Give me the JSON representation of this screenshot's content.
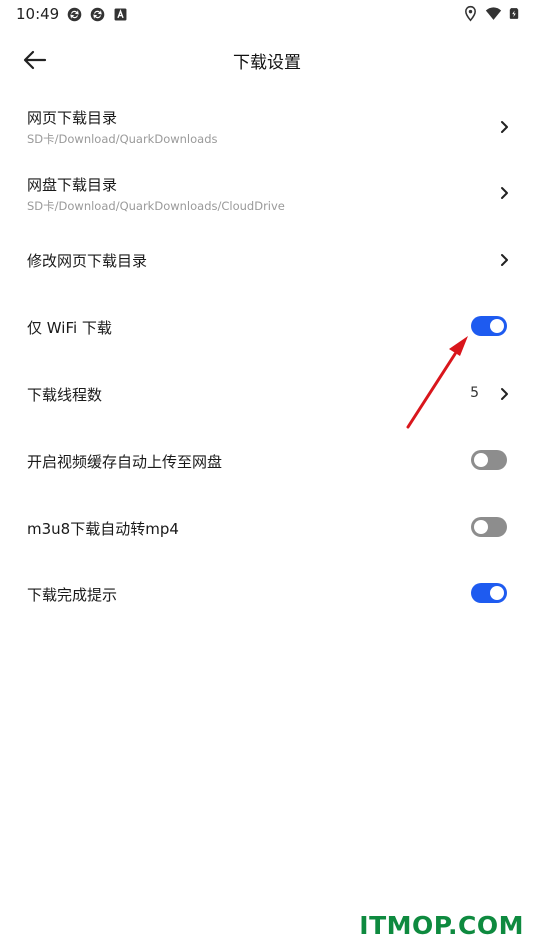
{
  "status_bar": {
    "time": "10:49",
    "icons_left": [
      "sync-icon",
      "sync-icon",
      "font-a-icon"
    ],
    "icons_right": [
      "location-icon",
      "wifi-icon",
      "battery-charging-icon"
    ]
  },
  "header": {
    "title": "下载设置",
    "back_icon": "arrow-left-icon"
  },
  "settings": {
    "web_dir": {
      "label": "网页下载目录",
      "sub": "SD卡/Download/QuarkDownloads"
    },
    "cloud_dir": {
      "label": "网盘下载目录",
      "sub": "SD卡/Download/QuarkDownloads/CloudDrive"
    },
    "modify_web_dir": {
      "label": "修改网页下载目录"
    },
    "wifi_only": {
      "label": "仅 WiFi 下载",
      "enabled": true
    },
    "threads": {
      "label": "下载线程数",
      "value": "5"
    },
    "video_cache_upload": {
      "label": "开启视频缓存自动上传至网盘",
      "enabled": false
    },
    "m3u8_to_mp4": {
      "label": "m3u8下载自动转mp4",
      "enabled": false
    },
    "complete_notice": {
      "label": "下载完成提示",
      "enabled": true
    }
  },
  "colors": {
    "toggle_on": "#1e5bf0",
    "toggle_off": "#8d8d8d",
    "annotation_arrow": "#d9161c",
    "watermark": "#0e8a3f"
  },
  "watermark": "ITMOP.COM"
}
